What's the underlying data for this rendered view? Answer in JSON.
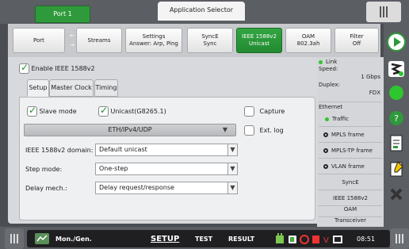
{
  "header": {
    "port_tab": "Port 1",
    "app_selector": "Application Selector"
  },
  "tabs": [
    {
      "line1": "Port",
      "line2": ""
    },
    {
      "line1": "Streams",
      "line2": ""
    },
    {
      "line1": "Settings",
      "line2": "Answer: Arp, Ping"
    },
    {
      "line1": "SyncE",
      "line2": "Sync"
    },
    {
      "line1": "IEEE 1588v2",
      "line2": "Unicast"
    },
    {
      "line1": "OAM",
      "line2": "802.3ah"
    },
    {
      "line1": "Filter",
      "line2": "Off"
    }
  ],
  "main": {
    "enable_label": "Enable IEEE 1588v2",
    "subtabs": [
      "Setup",
      "Master Clock",
      "Timing"
    ],
    "slave_mode_label": "Slave mode",
    "unicast_label": "Unicast(G8265.1)",
    "capture_label": "Capture",
    "ext_log_label": "Ext. log",
    "encapsulation": "ETH/IPv4/UDP",
    "domain_label": "IEEE 1588v2 domain:",
    "domain_value": "Default unicast",
    "step_label": "Step mode:",
    "step_value": "One-step",
    "delay_label": "Delay mech.:",
    "delay_value": "Delay request/response"
  },
  "status": {
    "link_label": "Link",
    "speed_label": "Speed:",
    "speed_value": "1 Gbps",
    "duplex_label": "Duplex:",
    "duplex_value": "FDX",
    "ethernet_label": "Ethernet",
    "traffic_label": "Traffic",
    "mpls_label": "MPLS frame",
    "mpls_tp_label": "MPLS-TP frame",
    "vlan_label": "VLAN frame",
    "synce_label": "SyncE",
    "ieee_label": "IEEE 1588v2",
    "oam_label": "OAM",
    "transceiver_label": "Transceiver"
  },
  "bottom": {
    "mode_label": "Mon./Gen.",
    "setup_label": "SETUP",
    "test_label": "TEST",
    "result_label": "RESULT",
    "time": "08:51"
  },
  "colors": {
    "accent_green": "#2f9a3b",
    "traffic_green": "#2ec52e"
  }
}
